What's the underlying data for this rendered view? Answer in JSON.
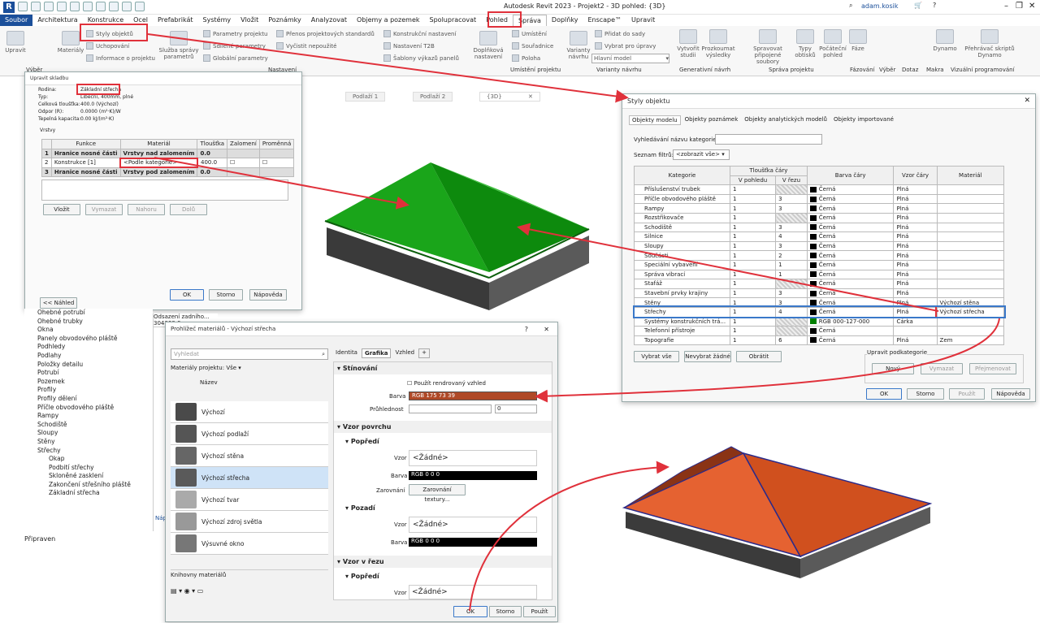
{
  "window": {
    "title": "Autodesk Revit 2023 - Projekt2 - 3D pohled: {3D}",
    "user": "adam.kosik"
  },
  "menubar": [
    "Soubor",
    "Architektura",
    "Konstrukce",
    "Ocel",
    "Prefabrikát",
    "Systémy",
    "Vložit",
    "Poznámky",
    "Analyzovat",
    "Objemy a pozemek",
    "Spolupracovat",
    "Pohled",
    "Správa",
    "Doplňky",
    "Enscape™",
    "Upravit"
  ],
  "ribbon": {
    "big": [
      "Upravit",
      "Materiály",
      "Služba správy parametrů",
      "Doplňková nastavení",
      "Varianty návrhu",
      "Vytvořit studii",
      "Prozkoumat výsledky",
      "Spravovat připojené soubory",
      "Typy obtisků",
      "Počáteční pohled",
      "Fáze",
      "Výběr",
      "Dotaz",
      "Makra",
      "Dynamo",
      "Přehrávač skriptů Dynamo"
    ],
    "small": [
      "Styly objektů",
      "Uchopování",
      "Informace o projektu",
      "Parametry projektu",
      "Sdílené parametry",
      "Globální parametry",
      "Přenos projektových standardů",
      "Vyčistit nepoužité",
      "Konstrukční nastavení",
      "Nastavení T2B",
      "Šablony výkazů panelů",
      "Umístění",
      "Souřadnice",
      "Poloha",
      "Přidat do sady",
      "Vybrat pro úpravy",
      "Hlavní model"
    ],
    "panels": [
      "Výběr",
      "Nastavení",
      "Umístění projektu",
      "Varianty návrhu",
      "Generativní návrh",
      "Správa projektu",
      "Fázování",
      "Výběr",
      "Dotaz",
      "Makra",
      "Vizuální programování"
    ]
  },
  "view_tabs": [
    "Podlaží 1",
    "Podlaží 2",
    "{3D}"
  ],
  "assembly": {
    "title": "Upravit skladbu",
    "family_label": "Rodina:",
    "family": "Základní střecha",
    "type_label": "Typ:",
    "type": "Libeční, 400mm, plné",
    "thick_label": "Celková tloušťka:",
    "thick": "400.0 (Výchozí)",
    "res_label": "Odpor (R):",
    "res": "0.0000 (m²·K)/W",
    "cap_label": "Tepelná kapacita:",
    "cap": "0.00 kJ/(m²·K)",
    "layers_label": "Vrstvy",
    "cols": [
      "Funkce",
      "Materiál",
      "Tloušťka",
      "Zalomení",
      "Proměnná"
    ],
    "rows": [
      [
        "1",
        "Hranice nosné části",
        "Vrstvy nad zalomením",
        "0.0",
        "",
        ""
      ],
      [
        "2",
        "Konstrukce [1]",
        "<Podle kategorie>",
        "400.0",
        "",
        ""
      ],
      [
        "3",
        "Hranice nosné části",
        "Vrstvy pod zalomením",
        "0.0",
        "",
        ""
      ]
    ],
    "buttons": [
      "Vložit",
      "Vymazat",
      "Nahoru",
      "Dolů"
    ],
    "preview": "<< Náhled",
    "ok": "OK",
    "cancel": "Storno",
    "help": "Nápověda"
  },
  "browser": {
    "items": [
      "Ohebné potrubí",
      "Ohebné trubky",
      "Okna",
      "Panely obvodového pláště",
      "Podhledy",
      "Podlahy",
      "Položky detailu",
      "Potrubí",
      "Pozemek",
      "Profily",
      "Profily dělení",
      "Příčle obvodového pláště",
      "Rampy",
      "Schodiště",
      "Sloupy",
      "Stěny",
      "Střechy",
      "Okap",
      "Podbití střechy",
      "Skloněné zasklení",
      "Zakončení střešního pláště",
      "Základní střecha"
    ],
    "status": "Připraven"
  },
  "props": {
    "offset": "Odsazení zadního... 304800.0",
    "lines": [
      "Ori",
      "Ori",
      "Kam",
      "Nas",
      "Nas",
      "Uza",
      "Res",
      "Výš",
      "Cíl",
      "Pos",
      "Iden",
      "Šab",
      "Náz",
      "Záv",
      "Nas",
      "Náz",
      "Fáz",
      "Filt",
      "Fáz"
    ],
    "help": "Náp"
  },
  "object_styles": {
    "title": "Styly objektu",
    "tabs": [
      "Objekty modelu",
      "Objekty poznámek",
      "Objekty analytických modelů",
      "Objekty importované"
    ],
    "search_label": "Vyhledávání názvu kategorie:",
    "filter_label": "Seznam filtrů:",
    "filter": "<zobrazit vše>",
    "cols": {
      "category": "Kategorie",
      "thick": "Tloušťka čáry",
      "in_view": "V pohledu",
      "in_section": "V řezu",
      "color": "Barva čáry",
      "pattern": "Vzor čáry",
      "material": "Materiál"
    },
    "rows": [
      [
        "Příslušenství trubek",
        "1",
        "",
        "Černá",
        "Plná",
        ""
      ],
      [
        "Příčle obvodového pláště",
        "1",
        "3",
        "Černá",
        "Plná",
        ""
      ],
      [
        "Rampy",
        "1",
        "3",
        "Černá",
        "Plná",
        ""
      ],
      [
        "Rozstřikovače",
        "1",
        "",
        "Černá",
        "Plná",
        ""
      ],
      [
        "Schodiště",
        "1",
        "3",
        "Černá",
        "Plná",
        ""
      ],
      [
        "Silnice",
        "1",
        "4",
        "Černá",
        "Plná",
        ""
      ],
      [
        "Sloupy",
        "1",
        "3",
        "Černá",
        "Plná",
        ""
      ],
      [
        "Součásti",
        "1",
        "2",
        "Černá",
        "Plná",
        ""
      ],
      [
        "Speciální vybavení",
        "1",
        "1",
        "Černá",
        "Plná",
        ""
      ],
      [
        "Správa vibrací",
        "1",
        "1",
        "Černá",
        "Plná",
        ""
      ],
      [
        "Stafáž",
        "1",
        "",
        "Černá",
        "Plná",
        ""
      ],
      [
        "Stavební prvky krajiny",
        "1",
        "3",
        "Černá",
        "Plná",
        ""
      ],
      [
        "Stěny",
        "1",
        "3",
        "Černá",
        "Plná",
        "Výchozí stěna"
      ],
      [
        "Střechy",
        "1",
        "4",
        "Černá",
        "Plná",
        "Výchozí střecha"
      ],
      [
        "Systémy konstrukčních trá...",
        "1",
        "",
        "RGB 000-127-000",
        "Čárka",
        ""
      ],
      [
        "Telefonní přístroje",
        "1",
        "",
        "Černá",
        "",
        ""
      ],
      [
        "Topografie",
        "1",
        "6",
        "Černá",
        "Plná",
        "Zem"
      ]
    ],
    "btn_all": "Vybrat vše",
    "btn_none": "Nevybrat žádné",
    "btn_invert": "Obrátit",
    "sub_label": "Upravit podkategorie",
    "btn_new": "Nový",
    "btn_delete": "Vymazat",
    "btn_rename": "Přejmenovat",
    "ok": "OK",
    "cancel": "Storno",
    "apply": "Použít",
    "help": "Nápověda"
  },
  "material_browser": {
    "title": "Prohlížeč materiálů - Výchozí střecha",
    "search_placeholder": "Vyhledat",
    "list_header": "Materiály projektu: Vše",
    "name_col": "Název",
    "items": [
      "Výchozí",
      "Výchozí podlaží",
      "Výchozí stěna",
      "Výchozí střecha",
      "Výchozí tvar",
      "Výchozí zdroj světla",
      "Výsuvné okno"
    ],
    "library": "Knihovny materiálů",
    "tabs": [
      "Identita",
      "Grafika",
      "Vzhled"
    ],
    "shading": "Stínování",
    "use_render": "Použít rendrovaný vzhled",
    "color_label": "Barva",
    "color_value": "RGB 175 73 39",
    "trans_label": "Průhlednost",
    "trans_value": "0",
    "surface": "Vzor povrchu",
    "foreground": "Popředí",
    "pattern_label": "Vzor",
    "pattern_value": "<Žádné>",
    "fg_color": "RGB 0 0 0",
    "align_label": "Zarovnání",
    "align_btn": "Zarovnání textury...",
    "background": "Pozadí",
    "bg_color": "RGB 0 0 0",
    "cut": "Vzor v řezu",
    "cut_fg": "Popředí",
    "ok": "OK",
    "cancel": "Storno",
    "apply": "Použít"
  },
  "colors": {
    "accent": "#1b4f9a",
    "highlight": "#e0313b",
    "green_roof": "#1e9a1e",
    "orange_roof": "#e2582a"
  }
}
